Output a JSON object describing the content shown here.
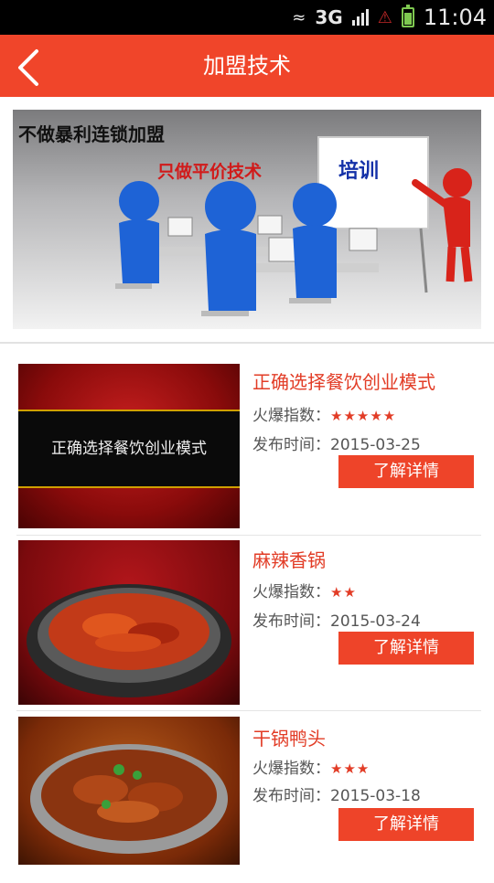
{
  "status_bar": {
    "network": "3G",
    "time": "11:04"
  },
  "header": {
    "title": "加盟技术",
    "back_icon": "chevron-left-icon",
    "background": "#f0452a"
  },
  "banner": {
    "line1": "不做暴利连锁加盟",
    "line2": "只做平价技术",
    "line3": "培训"
  },
  "list": {
    "hot_label": "火爆指数：",
    "date_label": "发布时间：",
    "button_label": "了解详情",
    "items": [
      {
        "title": "正确选择餐饮创业模式",
        "stars": "★★★★★",
        "rating": 5,
        "date": "2015-03-25",
        "thumb_caption": "正确选择餐饮创业模式"
      },
      {
        "title": "麻辣香锅",
        "stars": "★★",
        "rating": 2,
        "date": "2015-03-24"
      },
      {
        "title": "干锅鸭头",
        "stars": "★★★",
        "rating": 3,
        "date": "2015-03-18"
      }
    ]
  },
  "colors": {
    "accent": "#f0452a",
    "title_red": "#e23c26",
    "button": "#ee4429"
  }
}
